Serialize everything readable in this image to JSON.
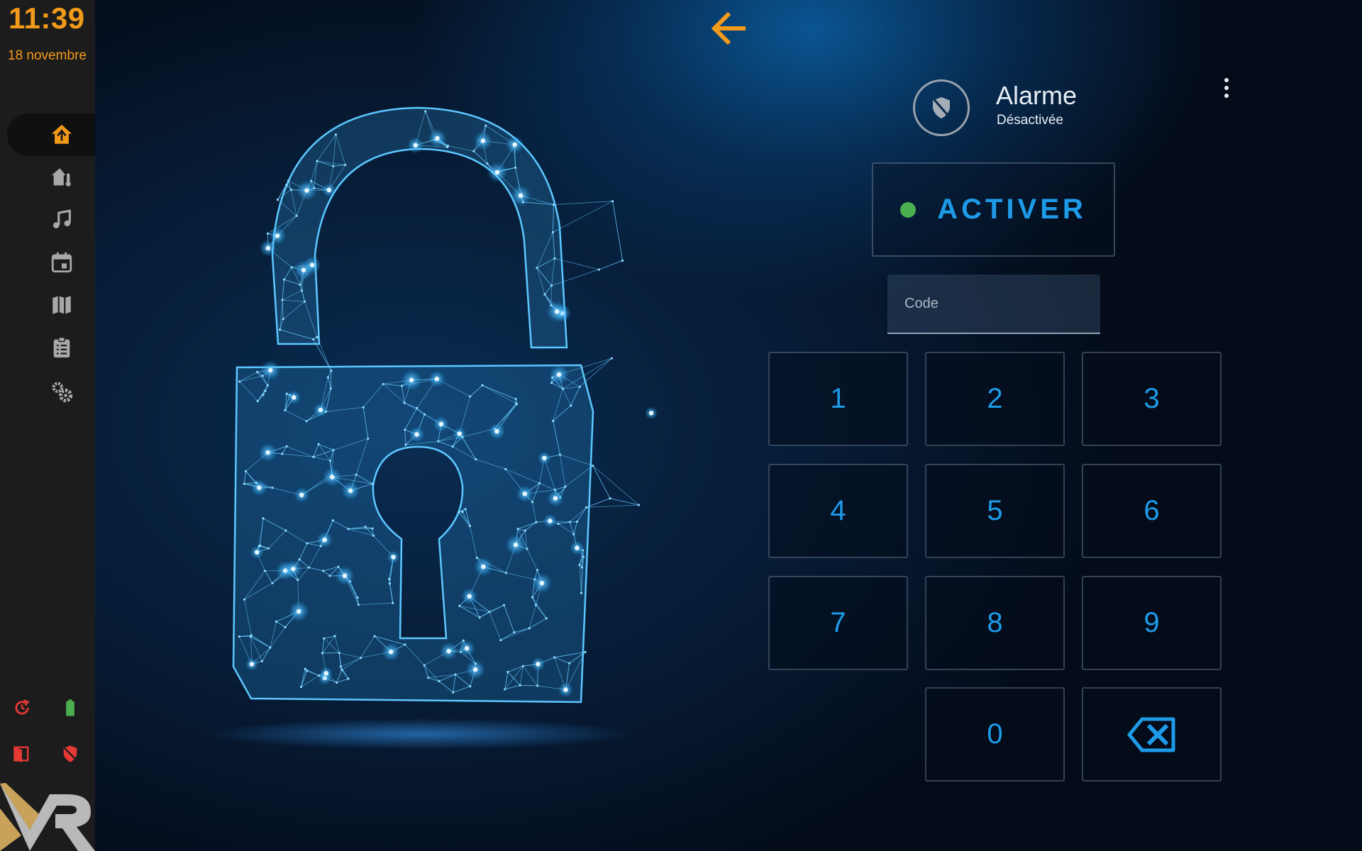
{
  "status_bar": {
    "time": "11:39",
    "date": "18 novembre"
  },
  "sidebar": {
    "items": [
      {
        "name": "home",
        "icon": "home-shield-icon",
        "active": true
      },
      {
        "name": "house",
        "icon": "home-thermometer-icon",
        "active": false
      },
      {
        "name": "music",
        "icon": "music-note-icon",
        "active": false
      },
      {
        "name": "calendar",
        "icon": "calendar-icon",
        "active": false
      },
      {
        "name": "map",
        "icon": "map-icon",
        "active": false
      },
      {
        "name": "tasks",
        "icon": "clipboard-list-icon",
        "active": false
      },
      {
        "name": "settings",
        "icon": "gears-icon",
        "active": false
      }
    ],
    "status_icons": [
      "refresh-icon",
      "battery-icon",
      "door-open-icon",
      "shield-off-icon"
    ]
  },
  "alarm": {
    "title": "Alarme",
    "state": "Désactivée",
    "activate_label": "ACTIVER",
    "code_placeholder": "Code"
  },
  "keypad": {
    "keys": [
      "1",
      "2",
      "3",
      "4",
      "5",
      "6",
      "7",
      "8",
      "9",
      "0"
    ],
    "backspace_icon": "backspace-icon"
  },
  "colors": {
    "accent": "#f29a1a",
    "key_text": "#1e9be8",
    "status_ok": "#4caf50",
    "status_alert": "#e53935",
    "sidebar_bg": "#1c1c1c"
  }
}
